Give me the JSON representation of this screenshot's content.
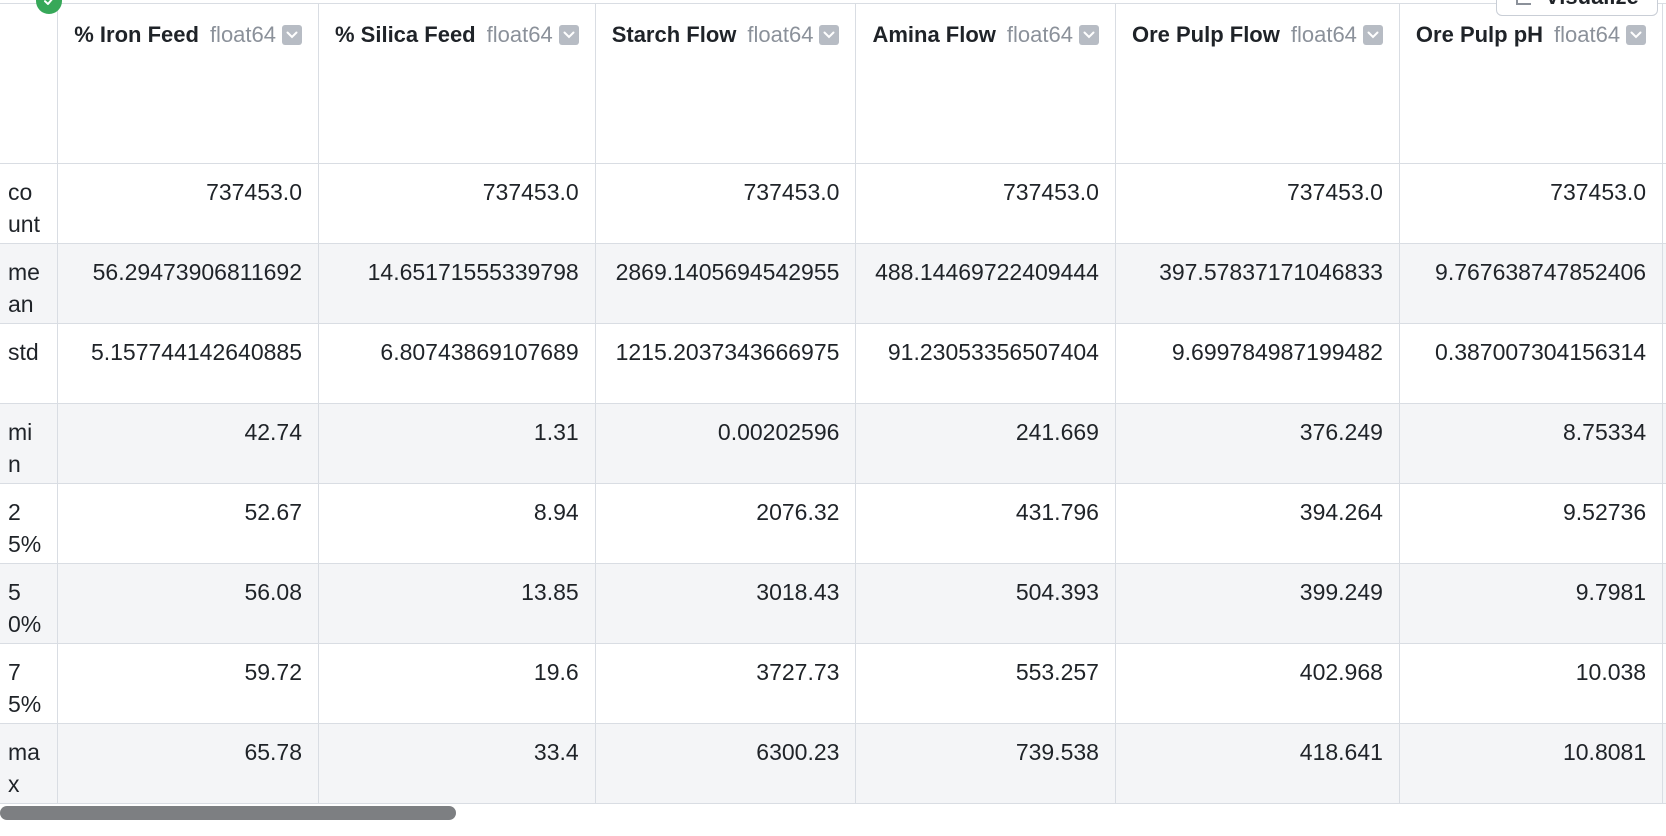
{
  "toolbar": {
    "visualize_label": "Visualize"
  },
  "columns": [
    {
      "name": "% Iron Feed",
      "type": "float64"
    },
    {
      "name": "% Silica Feed",
      "type": "float64"
    },
    {
      "name": "Starch Flow",
      "type": "float64"
    },
    {
      "name": "Amina Flow",
      "type": "float64"
    },
    {
      "name": "Ore Pulp Flow",
      "type": "float64"
    },
    {
      "name": "Ore Pulp pH",
      "type": "float64"
    }
  ],
  "rows": [
    {
      "label": "count",
      "values": [
        "737453.0",
        "737453.0",
        "737453.0",
        "737453.0",
        "737453.0",
        "737453.0"
      ]
    },
    {
      "label": "mean",
      "values": [
        "56.29473906811692",
        "14.65171555339798",
        "2869.1405694542955",
        "488.14469722409444",
        "397.57837171046833",
        "9.767638747852406"
      ]
    },
    {
      "label": "std",
      "values": [
        "5.157744142640885",
        "6.80743869107689",
        "1215.2037343666975",
        "91.23053356507404",
        "9.699784987199482",
        "0.387007304156314"
      ]
    },
    {
      "label": "min",
      "values": [
        "42.74",
        "1.31",
        "0.00202596",
        "241.669",
        "376.249",
        "8.75334"
      ]
    },
    {
      "label": "25%",
      "values": [
        "52.67",
        "8.94",
        "2076.32",
        "431.796",
        "394.264",
        "9.52736"
      ]
    },
    {
      "label": "50%",
      "values": [
        "56.08",
        "13.85",
        "3018.43",
        "504.393",
        "399.249",
        "9.7981"
      ]
    },
    {
      "label": "75%",
      "values": [
        "59.72",
        "19.6",
        "3727.73",
        "553.257",
        "402.968",
        "10.038"
      ]
    },
    {
      "label": "max",
      "values": [
        "65.78",
        "33.4",
        "6300.23",
        "739.538",
        "418.641",
        "10.8081"
      ]
    }
  ]
}
